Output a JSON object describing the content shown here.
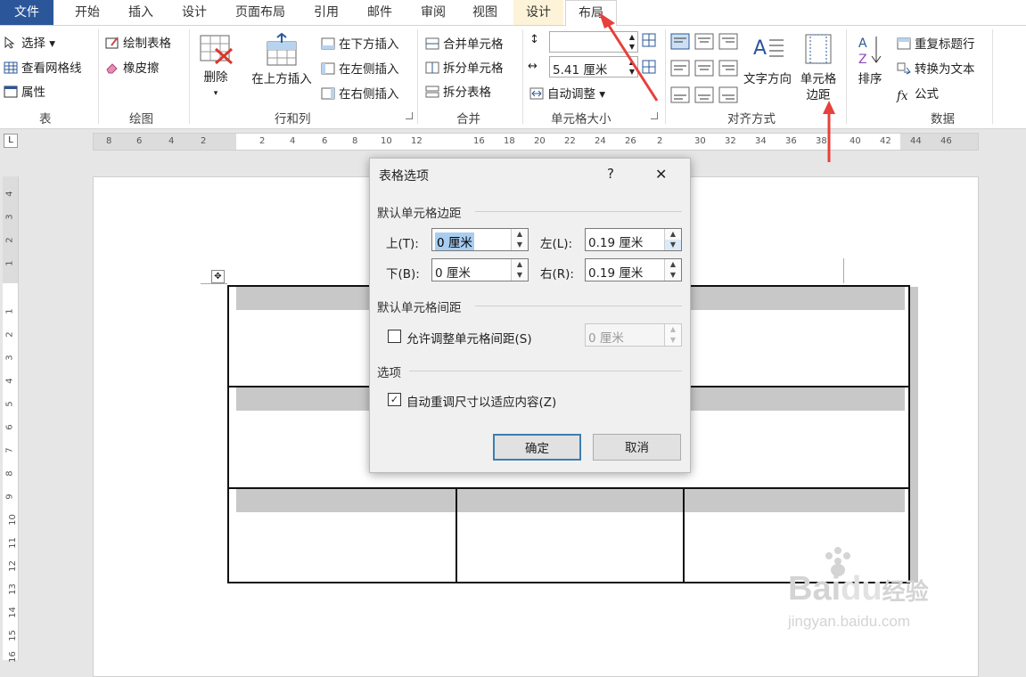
{
  "tabs": [
    {
      "label": "文件"
    },
    {
      "label": "开始"
    },
    {
      "label": "插入"
    },
    {
      "label": "设计"
    },
    {
      "label": "页面布局"
    },
    {
      "label": "引用"
    },
    {
      "label": "邮件"
    },
    {
      "label": "审阅"
    },
    {
      "label": "视图"
    },
    {
      "label": "设计"
    },
    {
      "label": "布局"
    }
  ],
  "ribbon": {
    "table_group": {
      "select": "选择",
      "gridlines": "查看网格线",
      "properties": "属性",
      "name": "表"
    },
    "draw_group": {
      "draw_table": "绘制表格",
      "eraser": "橡皮擦",
      "name": "绘图"
    },
    "rows_cols_group": {
      "delete": "删除",
      "insert_above": "在上方插入",
      "insert_below": "在下方插入",
      "insert_left": "在左侧插入",
      "insert_right": "在右侧插入",
      "name": "行和列"
    },
    "merge_group": {
      "merge_cells": "合并单元格",
      "split_cells": "拆分单元格",
      "split_table": "拆分表格",
      "name": "合并"
    },
    "cell_size_group": {
      "height_value": "",
      "width_value": "5.41 厘米",
      "autofit": "自动调整",
      "name": "单元格大小"
    },
    "alignment_group": {
      "text_direction": "文字方向",
      "cell_margins_line1": "单元格",
      "cell_margins_line2": "边距",
      "name": "对齐方式"
    },
    "data_group": {
      "sort": "排序",
      "repeat_header": "重复标题行",
      "convert_text": "转换为文本",
      "formula": "公式",
      "name": "数据"
    }
  },
  "ruler": {
    "corner": "L",
    "h_ticks": [
      "8",
      "6",
      "4",
      "2",
      "2",
      "4",
      "6",
      "8",
      "10",
      "12",
      "16",
      "18",
      "20",
      "22",
      "24",
      "26",
      "2",
      "30",
      "32",
      "34",
      "36",
      "38",
      "40",
      "42",
      "44",
      "46"
    ],
    "v_ticks": [
      "4",
      "3",
      "2",
      "1",
      "1",
      "2",
      "3",
      "4",
      "5",
      "6",
      "7",
      "8",
      "9",
      "10",
      "11",
      "12",
      "13",
      "14",
      "15",
      "16"
    ]
  },
  "dialog": {
    "title": "表格选项",
    "help": "?",
    "close": "✕",
    "margins_section": "默认单元格边距",
    "top_label": "上(T):",
    "top_value": "0 厘米",
    "bottom_label": "下(B):",
    "bottom_value": "0 厘米",
    "left_label": "左(L):",
    "left_value": "0.19 厘米",
    "right_label": "右(R):",
    "right_value": "0.19 厘米",
    "spacing_section": "默认单元格间距",
    "allow_spacing_label": "允许调整单元格间距(S)",
    "allow_spacing_checked": false,
    "spacing_value": "0 厘米",
    "options_section": "选项",
    "autofit_label": "自动重调尺寸以适应内容(Z)",
    "autofit_checked": true,
    "ok": "确定",
    "cancel": "取消"
  },
  "watermark": {
    "brand": "Bai",
    "brand2": "du",
    "suffix": "经验",
    "url": "jingyan.baidu.com"
  },
  "colors": {
    "file_tab": "#2b579a",
    "arrow": "#e8403a",
    "context_tab": "#fdf3d8"
  }
}
